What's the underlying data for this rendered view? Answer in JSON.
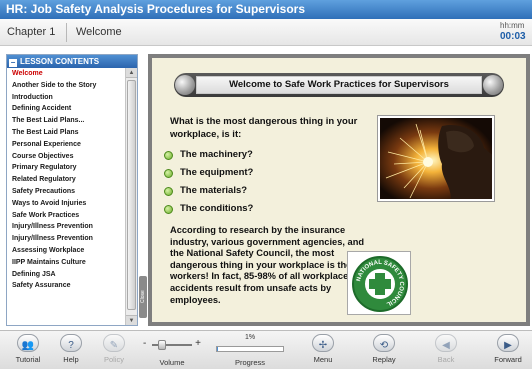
{
  "app": {
    "title": "HR: Job Safety Analysis Procedures for Supervisors"
  },
  "chapter": {
    "number": "Chapter 1",
    "name": "Welcome",
    "timer_label": "hh:mm",
    "timer_value": "00:03"
  },
  "sidebar": {
    "header": "LESSON CONTENTS",
    "collapse_tab": "Close",
    "items": [
      "Welcome",
      "Another Side to the Story",
      "Introduction",
      "Defining Accident",
      "The Best Laid Plans...",
      "The Best Laid Plans",
      "Personal Experience",
      "Course Objectives",
      "Primary Regulatory",
      "Related Regulatory",
      "Safety Precautions",
      "Ways to Avoid Injuries",
      "Safe Work Practices",
      "Injury/Illness Prevention",
      "Injury/Illness Prevention",
      "Assessing Workplace",
      "IIPP Maintains Culture",
      "Defining JSA",
      "Safety Assurance"
    ],
    "active_index": 0
  },
  "content": {
    "banner_title": "Welcome to Safe Work Practices for Supervisors",
    "question": "What is the most dangerous thing in your workplace, is it:",
    "options": [
      "The machinery?",
      "The equipment?",
      "The materials?",
      "The conditions?"
    ],
    "research": "According to research by the insurance industry, various government agencies, and the National Safety Council, the most dangerous thing in your workplace is the workers! In fact, 85-98% of all workplace accidents result from unsafe acts by employees.",
    "logo_text": "NATIONAL SAFETY COUNCIL"
  },
  "toolbar": {
    "tutorial": "Tutorial",
    "help": "Help",
    "policy": "Policy",
    "volume": "Volume",
    "volume_minus": "-",
    "volume_plus": "+",
    "volume_level": 0.25,
    "progress_label": "Progress",
    "progress_value": "1%",
    "progress_fraction": 0.01,
    "menu": "Menu",
    "replay": "Replay",
    "back": "Back",
    "forward": "Forward"
  },
  "colors": {
    "title_bar": "#3a7bc8",
    "accent_blue": "#1e5ea8",
    "active_item": "#cc0000",
    "bullet_green": "#6cae2a",
    "content_bg": "#f3f0dc"
  }
}
